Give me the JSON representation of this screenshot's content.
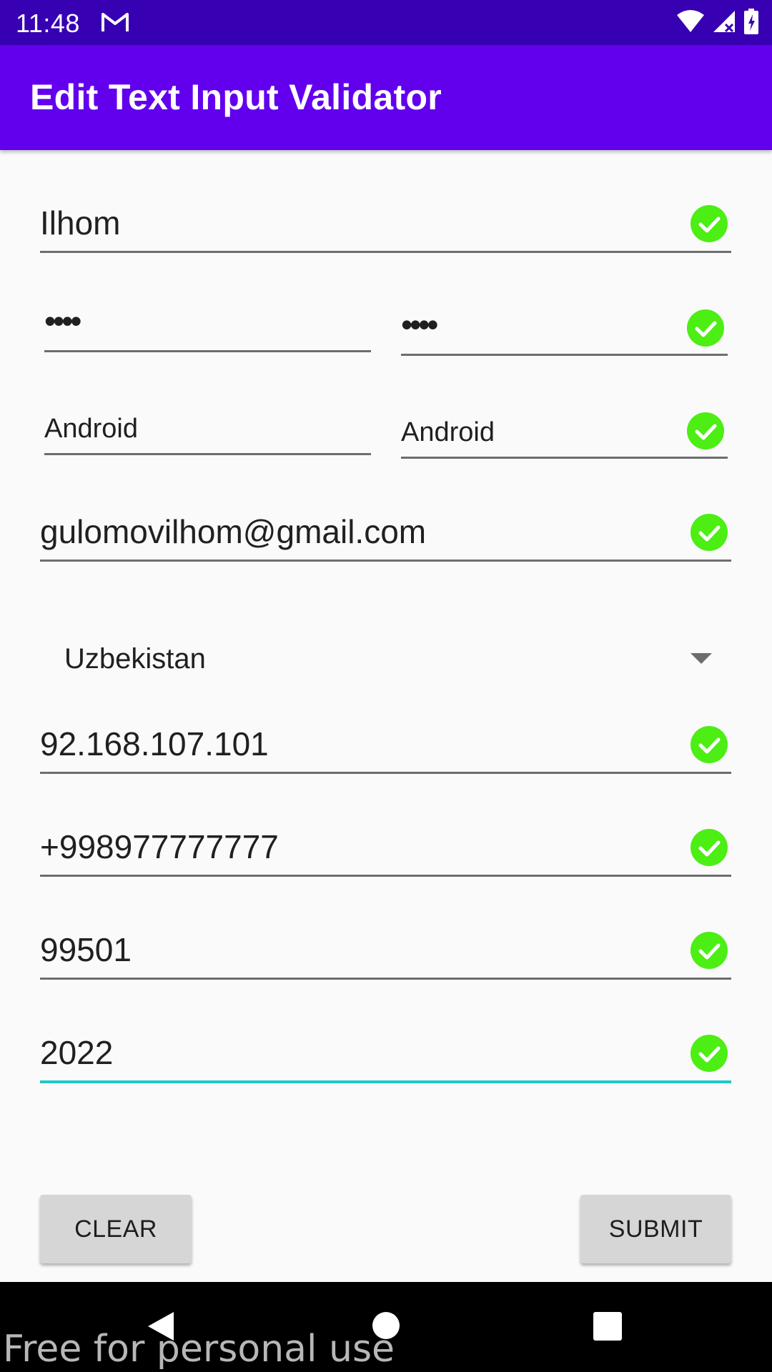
{
  "status_bar": {
    "time": "11:48",
    "icons": [
      "gmail-icon",
      "wifi-icon",
      "signal-icon",
      "battery-icon"
    ]
  },
  "app_bar": {
    "title": "Edit Text Input Validator"
  },
  "form": {
    "name": "Ilhom",
    "password": "••••",
    "confirm_password": "••••",
    "text_1": "Android",
    "text_2": "Android",
    "email": "gulomovilhom@gmail.com",
    "country": "Uzbekistan",
    "ip_address": "92.168.107.101",
    "phone": "+998977777777",
    "zip": "99501",
    "year": "2022"
  },
  "buttons": {
    "clear": "CLEAR",
    "submit": "SUBMIT"
  },
  "watermark": "Free for personal use",
  "colors": {
    "status_bar": "#3700b3",
    "app_bar": "#6200ee",
    "check": "#4cee14",
    "focus_line": "#1ec8c8"
  }
}
